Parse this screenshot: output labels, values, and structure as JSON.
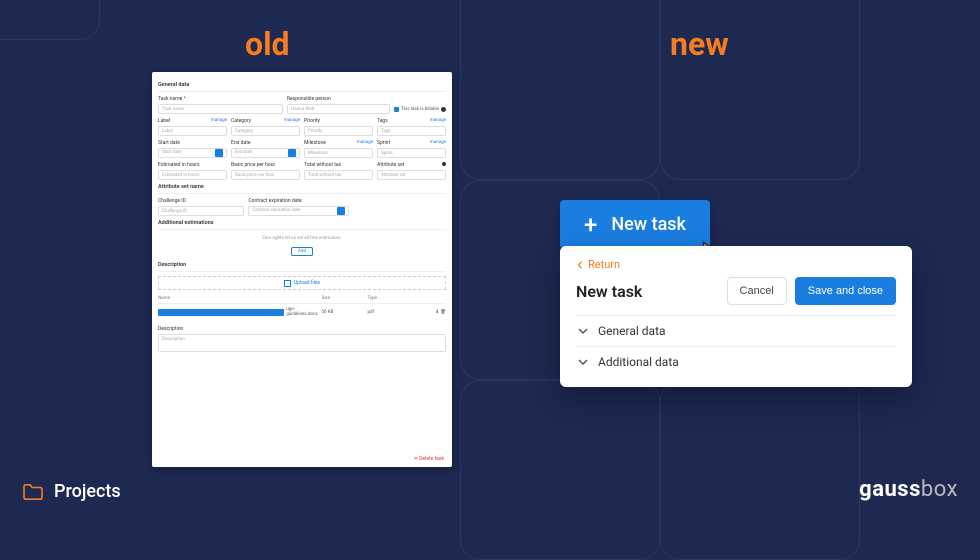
{
  "colors": {
    "accent_orange": "#f57c1f",
    "accent_blue": "#1a7de0",
    "bg": "#1e2952"
  },
  "headings": {
    "old": "old",
    "new": "new"
  },
  "old_form": {
    "sections": {
      "general": "General data",
      "attr_set": "Attribute set name",
      "additional": "Additional estimations",
      "description": "Description"
    },
    "labels": {
      "task_name": "Task name",
      "task_name_req": "*",
      "responsible": "Responsible person",
      "billable_checkbox": "This task is billable",
      "label": "Label",
      "category": "Category",
      "priority": "Priority",
      "tags": "Tags",
      "start_date": "Start date",
      "end_date": "End date",
      "milestone": "Milestone",
      "sprint": "Sprint",
      "est_hours": "Estimated in hours",
      "basic_price": "Basic price per hour",
      "total_no_tax": "Total without tax",
      "attribute_set": "Attribute set",
      "challenge_id": "Challenge ID",
      "contract_exp": "Contract expiration date",
      "manage": "manage"
    },
    "placeholders": {
      "task_name": "Task name",
      "responsible": "Hanna Watt",
      "label": "Label",
      "category": "Category",
      "priority": "Priority",
      "tags": "Tags",
      "start_date": "Start date",
      "end_date": "End date",
      "milestone": "Milestone",
      "sprint": "Sprint",
      "est_hours": "Estimated in hours",
      "basic_price": "Basic price per hour",
      "total_no_tax": "Total without tax",
      "attribute_set": "Attribute set",
      "challenge_id": "Challenge ID",
      "contract_exp": "Contract expiration date",
      "description": "Description"
    },
    "additional_hint": "Zero rights let us set all free estimators.",
    "add_button": "Add",
    "upload_label": "Upload files",
    "table": {
      "headers": {
        "name": "Name",
        "size": "Size",
        "type": "Type",
        "actions": ""
      },
      "row": {
        "name": "ugo-guidelines.docx",
        "size": "56 KB",
        "type": "pdf"
      }
    },
    "description_label": "Description",
    "delete": "Delete task"
  },
  "new_button": {
    "label": "New task"
  },
  "new_panel": {
    "return": "Return",
    "title": "New task",
    "cancel": "Cancel",
    "save": "Save and close",
    "sections": {
      "general": "General data",
      "additional": "Additional data"
    }
  },
  "footer": {
    "left": "Projects",
    "brand_a": "gauss",
    "brand_b": "box"
  }
}
